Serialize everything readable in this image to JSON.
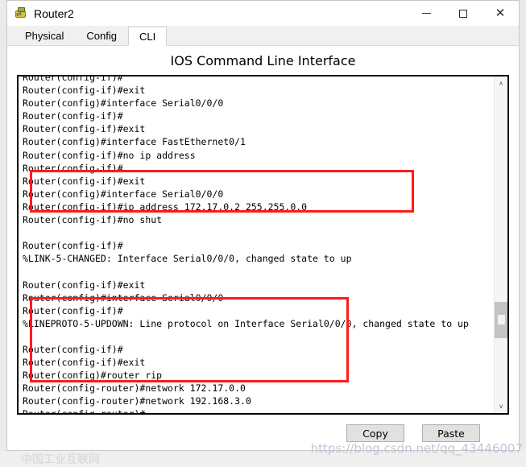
{
  "window": {
    "title": "Router2",
    "icon": "router-icon",
    "controls": {
      "minimize": "—",
      "maximize": "□",
      "close": "✕"
    }
  },
  "tabs": [
    {
      "label": "Physical",
      "active": false
    },
    {
      "label": "Config",
      "active": false
    },
    {
      "label": "CLI",
      "active": true
    }
  ],
  "panel": {
    "title": "IOS Command Line Interface"
  },
  "terminal": {
    "lines": [
      "Router(config-if)#",
      "Router(config-if)#exit",
      "Router(config)#interface Serial0/0/0",
      "Router(config-if)#",
      "Router(config-if)#exit",
      "Router(config)#interface FastEthernet0/1",
      "Router(config-if)#no ip address",
      "Router(config-if)#",
      "Router(config-if)#exit",
      "Router(config)#interface Serial0/0/0",
      "Router(config-if)#ip address 172.17.0.2 255.255.0.0",
      "Router(config-if)#no shut",
      "",
      "Router(config-if)#",
      "%LINK-5-CHANGED: Interface Serial0/0/0, changed state to up",
      "",
      "Router(config-if)#exit",
      "Router(config)#interface Serial0/0/0",
      "Router(config-if)#",
      "%LINEPROTO-5-UPDOWN: Line protocol on Interface Serial0/0/0, changed state to up",
      "",
      "Router(config-if)#",
      "Router(config-if)#exit",
      "Router(config)#router rip",
      "Router(config-router)#network 172.17.0.0",
      "Router(config-router)#network 192.168.3.0",
      "Router(config-router)#"
    ],
    "highlight_color": "#ff1a1a",
    "annotations": [
      {
        "name": "serial-interface-config-box",
        "lines": [
          "Router(config)#interface Serial0/0/0",
          "Router(config-if)#ip address 172.17.0.2 255.255.0.0",
          "Router(config-if)#no shut"
        ]
      },
      {
        "name": "rip-routing-config-box",
        "lines": [
          "Router(config-if)#",
          "Router(config-if)#exit",
          "Router(config)#router rip",
          "Router(config-router)#network 172.17.0.0",
          "Router(config-router)#network 192.168.3.0",
          "Router(config-router)#"
        ]
      }
    ]
  },
  "scrollbar": {
    "up_arrow": "∧",
    "down_arrow": "∨"
  },
  "buttons": {
    "copy": "Copy",
    "paste": "Paste"
  },
  "watermarks": {
    "right": "https://blog.csdn.net/qq_43446007",
    "left": "中国工业互联网"
  }
}
